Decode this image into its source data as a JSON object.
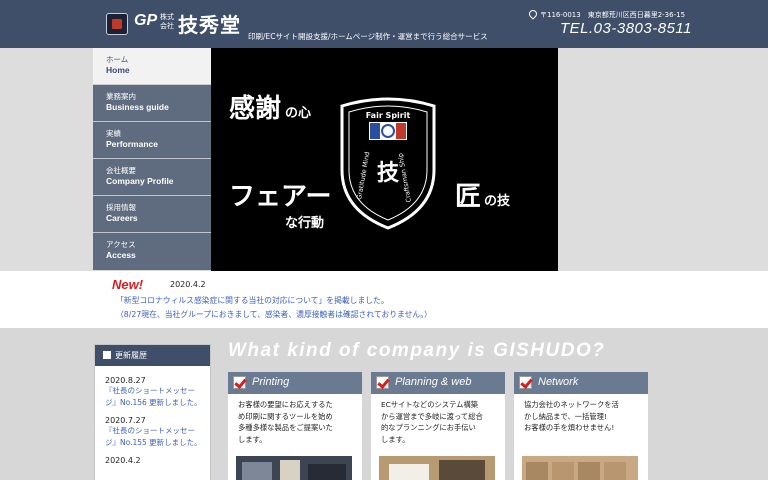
{
  "header": {
    "kabu": "株式会社",
    "company_name": "技秀堂",
    "logo_mark": "GP",
    "tagline": "印刷/ECサイト開設支援/ホームページ制作・運営まで行う総合サービス",
    "address": "〒116-0013　東京都荒川区西日暮里2-36-15",
    "tel": "TEL.03-3803-8511",
    "colors": {
      "header_bg": "#3f4f6a",
      "accent_red": "#d71e1e",
      "link_blue": "#3b5fc0"
    }
  },
  "nav": [
    {
      "jp": "ホーム",
      "en": "Home"
    },
    {
      "jp": "業務案内",
      "en": "Business guide"
    },
    {
      "jp": "実績",
      "en": "Performance"
    },
    {
      "jp": "会社概要",
      "en": "Company Profile"
    },
    {
      "jp": "採用情報",
      "en": "Careers"
    },
    {
      "jp": "アクセス",
      "en": "Access"
    }
  ],
  "hero": {
    "kansha": "感謝",
    "no_kokoro": "の心",
    "fair": "フェアー",
    "na_koudou": "な行動",
    "takumi": "匠",
    "no_waza": "の技",
    "shield_top": "Fair Spirit",
    "shield_left": "Gratitude Mind",
    "shield_right": "Craftsman Ship",
    "shield_center": "技"
  },
  "news": {
    "badge": "New!",
    "date": "2020.4.2",
    "line1": "「新型コロナウィルス感染症に関する当社の対応について」を掲載しました。",
    "line2": "（8/27現在、当社グループにおきまして、感染者、濃厚接触者は確認されておりません。）"
  },
  "history": {
    "title": "更新履歴",
    "items": [
      {
        "date": "2020.8.27",
        "text1": "『社長のショートメッセー",
        "text2": "ジ』No.156 更新しました。"
      },
      {
        "date": "2020.7.27",
        "text1": "『社長のショートメッセー",
        "text2": "ジ』No.155 更新しました。"
      },
      {
        "date": "2020.4.2",
        "text1": "",
        "text2": ""
      }
    ]
  },
  "what": {
    "title": "What kind of company is GISHUDO?"
  },
  "cards": [
    {
      "title": "Printing",
      "l1": "お客様の要望にお応えするた",
      "l2": "め印刷に関するツールを始め",
      "l3": "多種多様な製品をご提案いた",
      "l4": "します。"
    },
    {
      "title": "Planning & web",
      "l1": "ECサイトなどのシステム構築",
      "l2": "から運営まで多岐に渡って総合",
      "l3": "的なプランニングにお手伝い",
      "l4": "します。"
    },
    {
      "title": "Network",
      "l1": "協力会社のネットワークを活",
      "l2": "かし納品まで、一括管理!",
      "l3": "お客様の手を煩わせません!",
      "l4": ""
    }
  ]
}
